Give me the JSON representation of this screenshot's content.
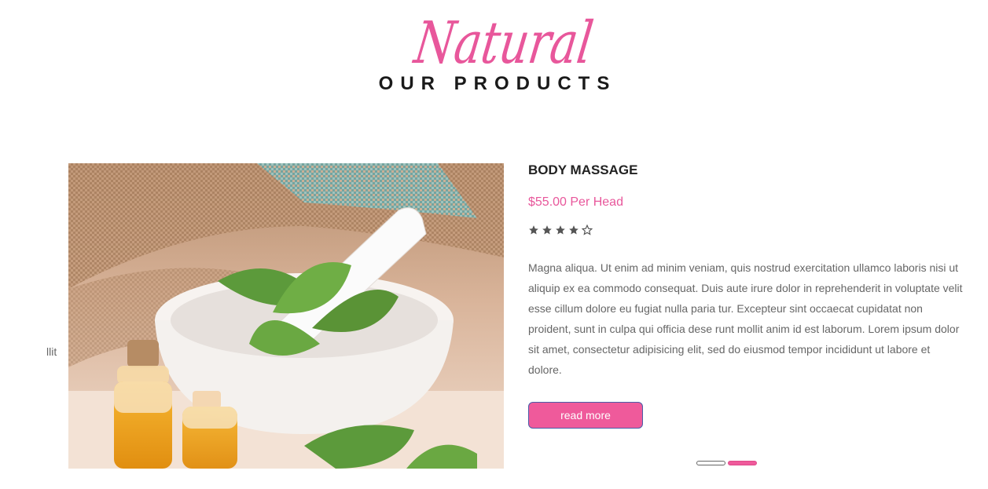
{
  "section": {
    "script_heading": "Natural",
    "heading": "OUR PRODUCTS",
    "accent_color": "#ef5a9b"
  },
  "slider": {
    "prev_slide_fragment": "llit",
    "active_slide": 2,
    "total_slides": 2,
    "dots": [
      "inactive",
      "active"
    ]
  },
  "product": {
    "image_icon": "herbal-mortar-oils-photo",
    "title": "BODY MASSAGE",
    "price": "$55.00 Per Head",
    "rating": 4,
    "rating_max": 5,
    "description_lines": [
      "Magna aliqua. Ut enim ad minim veniam, quis nostrud exercitation ullamco laboris nisi ut",
      "aliquip ex ea commodo consequat. Duis aute irure dolor in reprehenderit in voluptate velit",
      "esse cillum dolore eu fugiat nulla paria tur. Excepteur sint occaecat cupidatat non",
      "proident, sunt in culpa qui officia dese runt mollit anim id est laborum. Lorem ipsum dolor",
      "sit amet, consectetur adipisicing elit, sed do eiusmod tempor incididunt ut labore et",
      "dolore."
    ],
    "button_label": "read more"
  }
}
